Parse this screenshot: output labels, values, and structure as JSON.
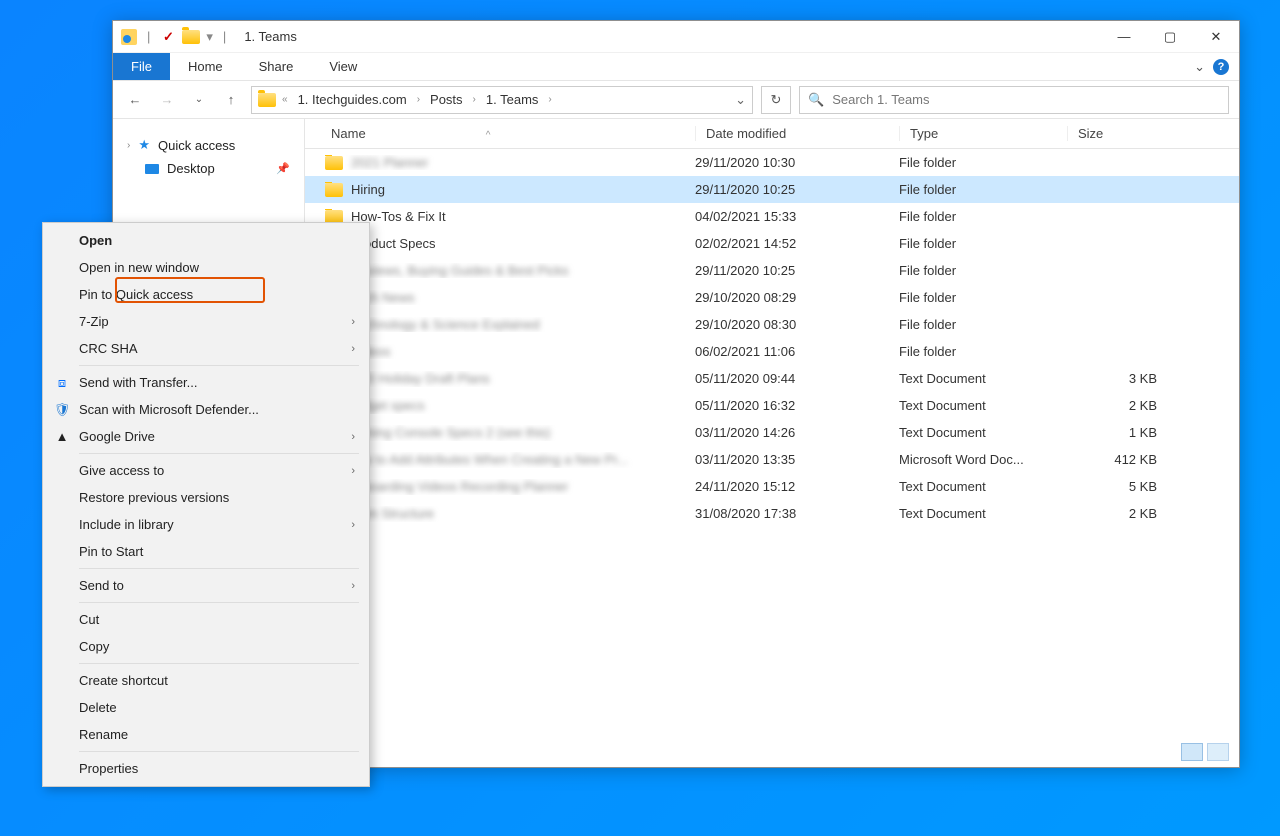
{
  "titlebar": {
    "dropdown": "▾",
    "title": "1. Teams"
  },
  "tabs": {
    "file": "File",
    "home": "Home",
    "share": "Share",
    "view": "View"
  },
  "breadcrumb": {
    "items": [
      "1. Itechguides.com",
      "Posts",
      "1. Teams"
    ]
  },
  "search": {
    "placeholder": "Search 1. Teams"
  },
  "sidebar": {
    "quick_access": "Quick access",
    "desktop": "Desktop"
  },
  "columns": {
    "name": "Name",
    "date": "Date modified",
    "type": "Type",
    "size": "Size"
  },
  "files": [
    {
      "name": "2021 Planner",
      "name_blur": true,
      "date": "29/11/2020 10:30",
      "type": "File folder",
      "size": "",
      "icon": "folder"
    },
    {
      "name": "Hiring",
      "name_blur": false,
      "date": "29/11/2020 10:25",
      "type": "File folder",
      "size": "",
      "icon": "folder",
      "selected": true
    },
    {
      "name": "How-Tos & Fix It",
      "name_blur": false,
      "date": "04/02/2021 15:33",
      "type": "File folder",
      "size": "",
      "icon": "folder"
    },
    {
      "name": "Product Specs",
      "name_blur": false,
      "date": "02/02/2021 14:52",
      "type": "File folder",
      "size": "",
      "icon": "folder"
    },
    {
      "name": "Reviews, Buying Guides & Best Picks",
      "name_blur": true,
      "date": "29/11/2020 10:25",
      "type": "File folder",
      "size": "",
      "icon": "folder"
    },
    {
      "name": "Tech News",
      "name_blur": true,
      "date": "29/10/2020 08:29",
      "type": "File folder",
      "size": "",
      "icon": "folder"
    },
    {
      "name": "Technology & Science Explained",
      "name_blur": true,
      "date": "29/10/2020 08:30",
      "type": "File folder",
      "size": "",
      "icon": "folder"
    },
    {
      "name": "Videos",
      "name_blur": true,
      "date": "06/02/2021 11:06",
      "type": "File folder",
      "size": "",
      "icon": "folder"
    },
    {
      "name": "2020 Holiday Draft Plans",
      "name_blur": true,
      "date": "05/11/2020 09:44",
      "type": "Text Document",
      "size": "3 KB",
      "icon": "txt"
    },
    {
      "name": "Budget specs",
      "name_blur": true,
      "date": "05/11/2020 16:32",
      "type": "Text Document",
      "size": "2 KB",
      "icon": "txt"
    },
    {
      "name": "Gaming Console Specs 2 (see this)",
      "name_blur": true,
      "date": "03/11/2020 14:26",
      "type": "Text Document",
      "size": "1 KB",
      "icon": "txt"
    },
    {
      "name": "How to Add Attributes When Creating a New Pr...",
      "name_blur": true,
      "date": "03/11/2020 13:35",
      "type": "Microsoft Word Doc...",
      "size": "412 KB",
      "icon": "doc"
    },
    {
      "name": "Onboarding Videos Recording Planner",
      "name_blur": true,
      "date": "24/11/2020 15:12",
      "type": "Text Document",
      "size": "5 KB",
      "icon": "txt"
    },
    {
      "name": "Team Structure",
      "name_blur": true,
      "date": "31/08/2020 17:38",
      "type": "Text Document",
      "size": "2 KB",
      "icon": "txt"
    }
  ],
  "context_menu": {
    "open": "Open",
    "open_new_window": "Open in new window",
    "pin_quick_access": "Pin to Quick access",
    "seven_zip": "7-Zip",
    "crc_sha": "CRC SHA",
    "send_transfer": "Send with Transfer...",
    "defender": "Scan with Microsoft Defender...",
    "gdrive": "Google Drive",
    "give_access": "Give access to",
    "restore": "Restore previous versions",
    "include_library": "Include in library",
    "pin_start": "Pin to Start",
    "send_to": "Send to",
    "cut": "Cut",
    "copy": "Copy",
    "shortcut": "Create shortcut",
    "delete": "Delete",
    "rename": "Rename",
    "properties": "Properties"
  }
}
